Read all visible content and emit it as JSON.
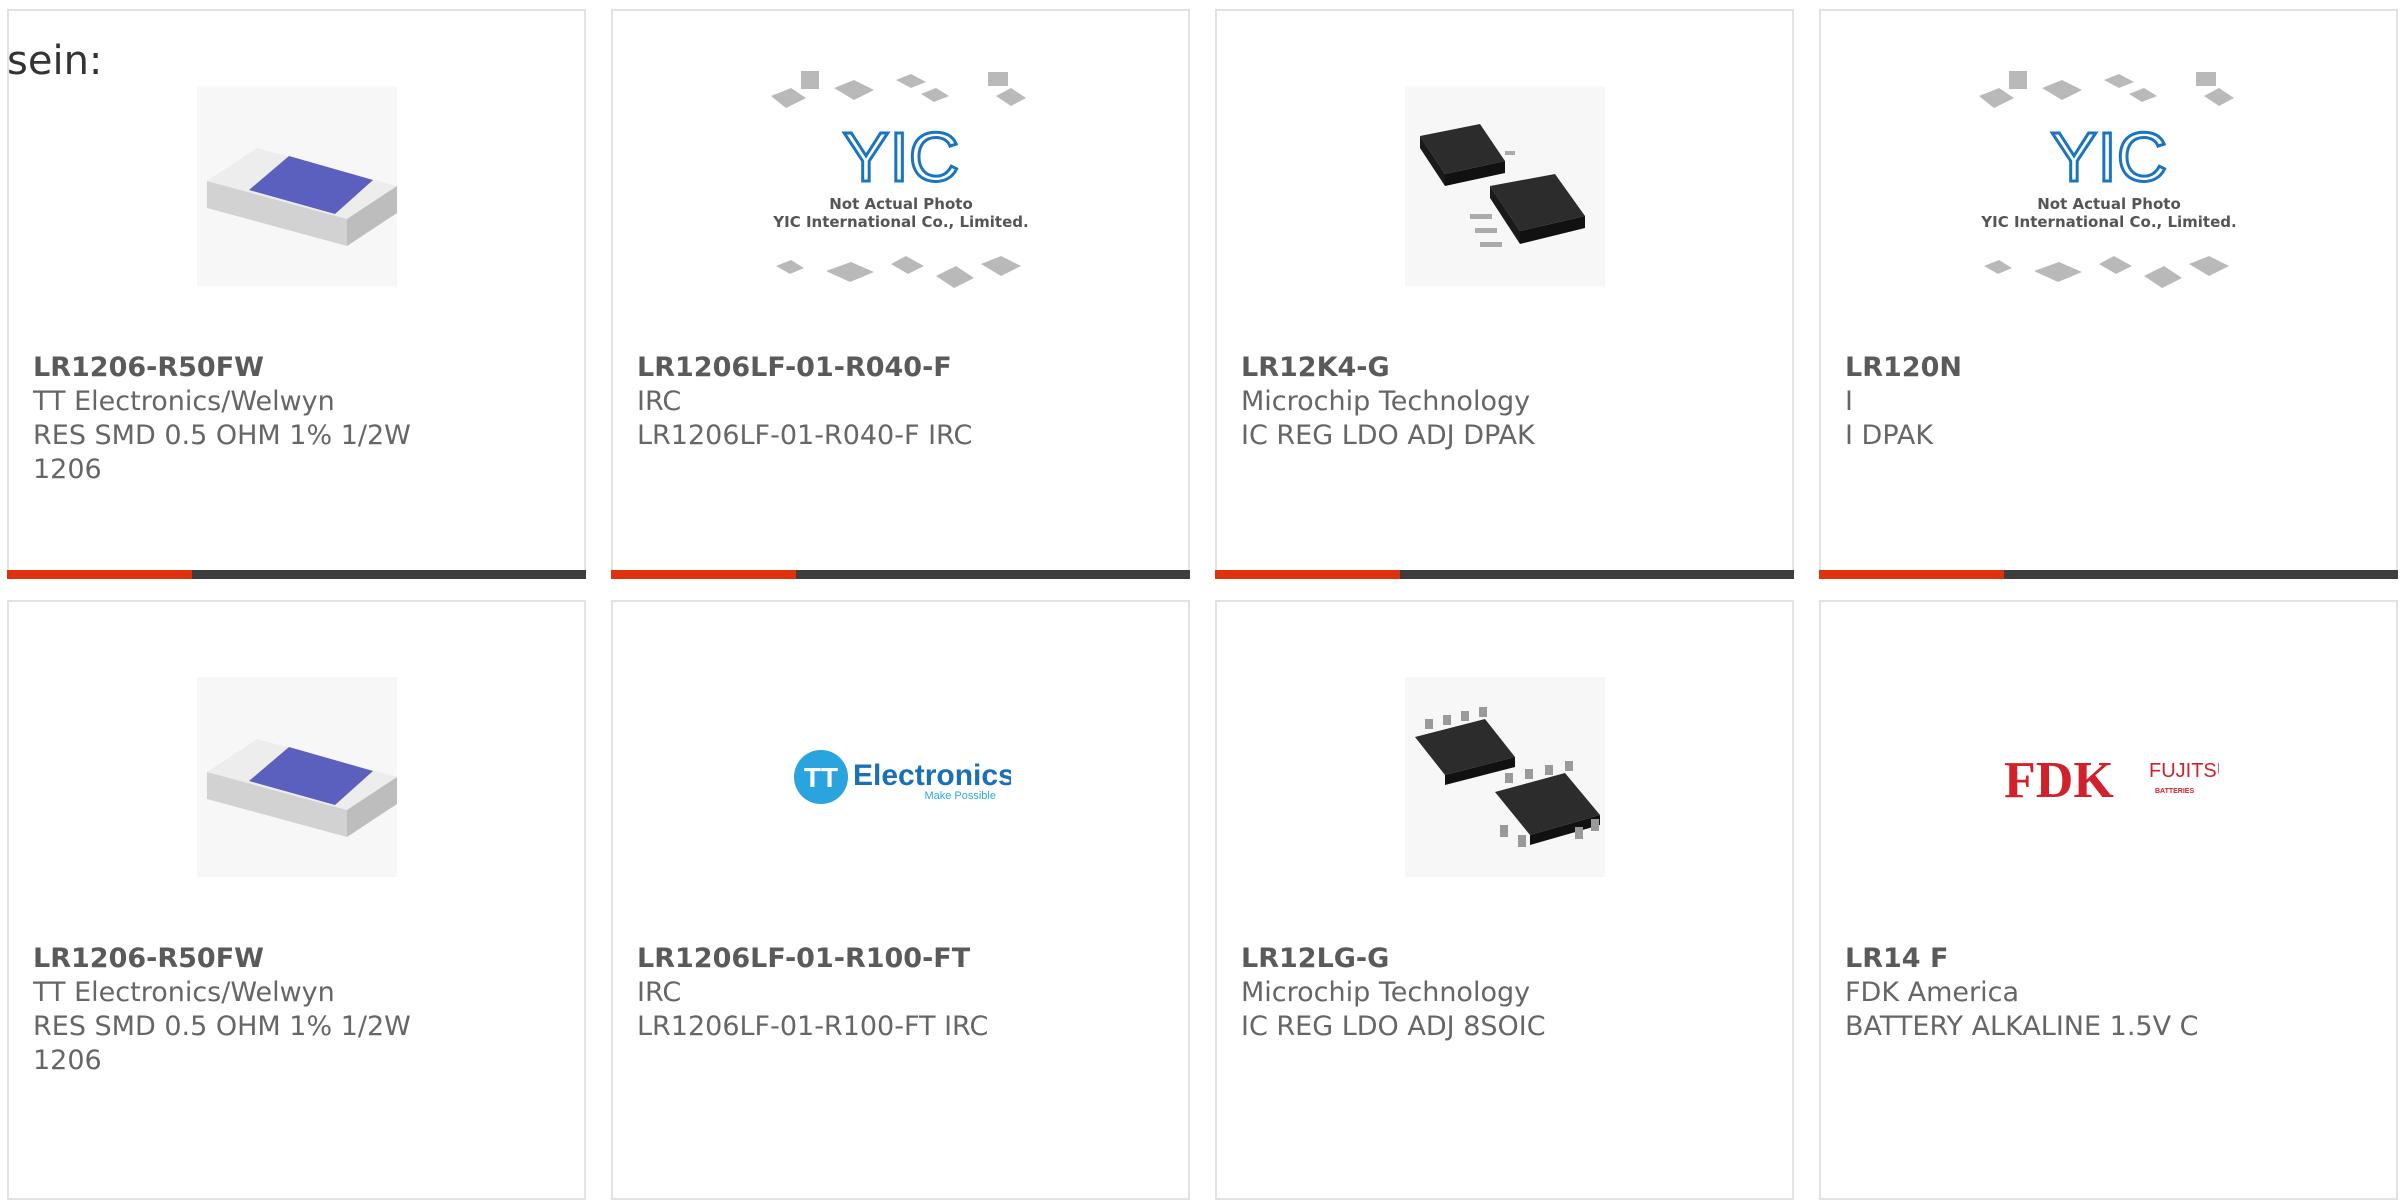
{
  "top_text": "sein:",
  "products": [
    {
      "part_number": "LR1206-R50FW",
      "manufacturer": "TT Electronics/Welwyn",
      "description_lines": [
        "RES SMD 0.5 OHM 1% 1/2W",
        "1206"
      ],
      "image": "smd-resistor-image"
    },
    {
      "part_number": "LR1206LF-01-R040-F",
      "manufacturer": "IRC",
      "description_lines": [
        "LR1206LF-01-R040-F IRC"
      ],
      "image": "yic-placeholder-image",
      "image_text": [
        "YIC",
        "Not Actual Photo",
        "YIC International Co., Limited."
      ]
    },
    {
      "part_number": "LR12K4-G",
      "manufacturer": "Microchip Technology",
      "description_lines": [
        "IC REG LDO ADJ DPAK"
      ],
      "image": "dpak-package-image"
    },
    {
      "part_number": "LR120N",
      "manufacturer": "I",
      "description_lines": [
        "I DPAK"
      ],
      "image": "yic-placeholder-image",
      "image_text": [
        "YIC",
        "Not Actual Photo",
        "YIC International Co., Limited."
      ]
    },
    {
      "part_number": "LR1206-R50FW",
      "manufacturer": "TT Electronics/Welwyn",
      "description_lines": [
        "RES SMD 0.5 OHM 1% 1/2W",
        "1206"
      ],
      "image": "smd-resistor-image"
    },
    {
      "part_number": "LR1206LF-01-R100-FT",
      "manufacturer": "IRC",
      "description_lines": [
        "LR1206LF-01-R100-FT IRC"
      ],
      "image": "tt-electronics-logo",
      "image_text": [
        "TT",
        "Electronics",
        "Make Possible"
      ]
    },
    {
      "part_number": "LR12LG-G",
      "manufacturer": "Microchip Technology",
      "description_lines": [
        "IC REG LDO ADJ 8SOIC"
      ],
      "image": "soic8-package-image"
    },
    {
      "part_number": "LR14 F",
      "manufacturer": "FDK America",
      "description_lines": [
        "BATTERY ALKALINE 1.5V C"
      ],
      "image": "fdk-fujitsu-logo",
      "image_text": [
        "FDK",
        "FUJITSU",
        "BATTERIES"
      ]
    }
  ],
  "colors": {
    "accent": "#e0310f",
    "bar": "#3d3d3d",
    "border": "#e2e2e2"
  }
}
